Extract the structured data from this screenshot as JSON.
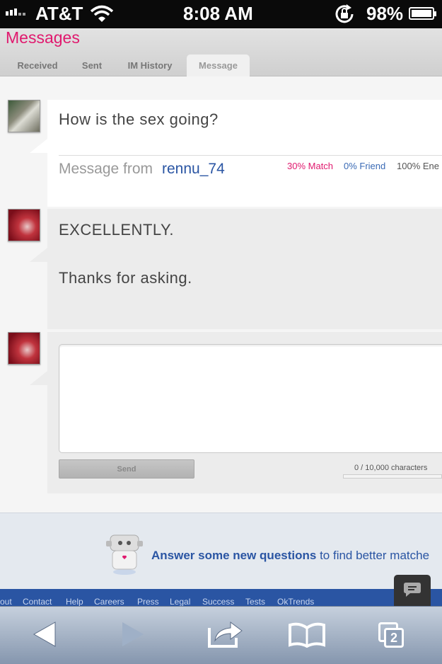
{
  "status": {
    "carrier": "AT&T",
    "time": "8:08 AM",
    "battery": "98%"
  },
  "header": {
    "title": "Messages",
    "tabs": [
      "Received",
      "Sent",
      "IM History",
      "Message"
    ]
  },
  "thread": [
    {
      "text": "How is the sex going?",
      "from_label": "Message from",
      "username": "rennu_74",
      "match": "30% Match",
      "friend": "0% Friend",
      "enemy": "100% Ene"
    },
    {
      "lines": [
        "EXCELLENTLY.",
        "Thanks for asking."
      ]
    }
  ],
  "compose": {
    "send_label": "Send",
    "char_count": "0 / 10,000 characters",
    "value": ""
  },
  "promo": {
    "bold": "Answer some new questions",
    "rest": "to find better matche"
  },
  "footer_links": [
    "out",
    "Contact",
    "Help",
    "Careers",
    "Press",
    "Legal",
    "Success",
    "Tests",
    "OkTrends"
  ],
  "toolbar": {
    "tabs_count": "2"
  },
  "colors": {
    "brand_pink": "#e0196e",
    "link_blue": "#2a55a3",
    "friend_blue": "#3a6ab5"
  }
}
